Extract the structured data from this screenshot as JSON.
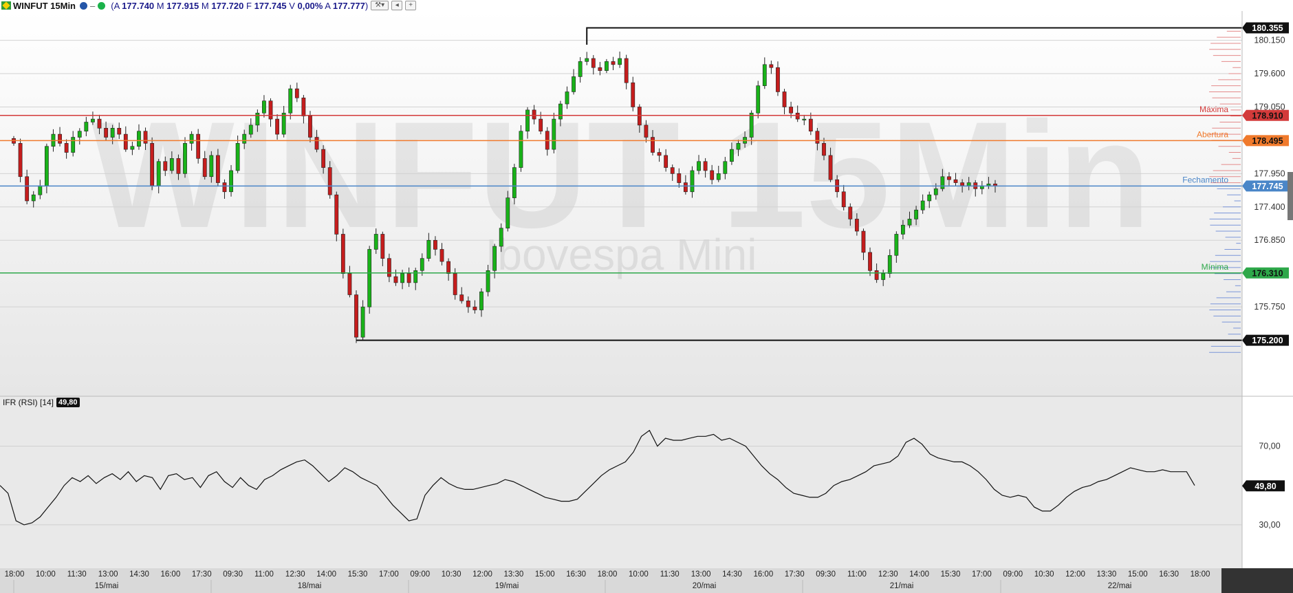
{
  "header": {
    "symbol": "WINFUT 15Min",
    "ohlc": [
      {
        "label": "A",
        "value": "177.740"
      },
      {
        "label": "M",
        "value": "177.915"
      },
      {
        "label": "M",
        "value": "177.720"
      },
      {
        "label": "F",
        "value": "177.745"
      },
      {
        "label": "V",
        "value": "0,00%"
      },
      {
        "label": "A",
        "value": "177.777"
      }
    ],
    "dropdown_value": "7"
  },
  "watermark": {
    "title": "WINFUT 15Min",
    "subtitle": "Ibovespa Mini"
  },
  "colors": {
    "up": "#19b219",
    "down": "#c51d1d",
    "maxima": "#d33a3a",
    "abertura": "#f07a2c",
    "fechamento": "#4a86c8",
    "minima": "#2ea84a"
  },
  "chart_data": [
    {
      "type": "candlestick",
      "title": "WINFUT 15Min",
      "ylim": [
        174900,
        180520
      ],
      "y_ticks": [
        "180.150",
        "179.600",
        "179.050",
        "177.950",
        "177.400",
        "176.850",
        "175.750"
      ],
      "ref_lines": [
        {
          "label": "Máxima",
          "value": 178910,
          "badge": "178.910",
          "color": "#d33a3a"
        },
        {
          "label": "Abertura",
          "value": 178495,
          "badge": "178.495",
          "color": "#f07a2c"
        },
        {
          "label": "Fechamento",
          "value": 177745,
          "badge": "177.745",
          "color": "#4a86c8"
        },
        {
          "label": "Mínima",
          "value": 176310,
          "badge": "176.310",
          "color": "#2ea84a"
        }
      ],
      "period_high": {
        "value": 180355,
        "label": "180.355"
      },
      "period_low": {
        "value": 175200,
        "label": "175.200"
      },
      "x_ticks": [
        "18:00",
        "10:00",
        "11:30",
        "13:00",
        "14:30",
        "16:00",
        "17:30",
        "09:30",
        "11:00",
        "12:30",
        "14:00",
        "15:30",
        "17:00",
        "09:00",
        "10:30",
        "12:00",
        "13:30",
        "15:00",
        "16:30",
        "18:00",
        "10:00",
        "11:30",
        "13:00",
        "14:30",
        "16:00",
        "17:30",
        "09:30",
        "11:00",
        "12:30",
        "14:00",
        "15:30",
        "17:00",
        "09:00",
        "10:30",
        "12:00",
        "13:30",
        "15:00",
        "16:30",
        "18:00"
      ],
      "day_labels": [
        "15/mai",
        "18/mai",
        "19/mai",
        "20/mai",
        "21/mai",
        "22/mai"
      ],
      "series_close": [
        178450,
        177900,
        177500,
        177600,
        177750,
        178400,
        178600,
        178450,
        178300,
        178550,
        178650,
        178800,
        178850,
        178700,
        178550,
        178700,
        178600,
        178350,
        178400,
        178650,
        178450,
        177750,
        178150,
        178000,
        178200,
        177950,
        178450,
        178600,
        178200,
        177900,
        178250,
        177800,
        177650,
        178000,
        178450,
        178600,
        178750,
        178950,
        179150,
        178850,
        178600,
        178950,
        179350,
        179200,
        178900,
        178550,
        178350,
        178050,
        177600,
        176950,
        176300,
        175950,
        175250,
        175750,
        176700,
        176950,
        176550,
        176250,
        176150,
        176300,
        176150,
        176350,
        176550,
        176850,
        176700,
        176500,
        176300,
        175950,
        175850,
        175750,
        175700,
        176000,
        176350,
        176750,
        177050,
        177550,
        178050,
        178650,
        179000,
        178850,
        178650,
        178350,
        178850,
        179100,
        179300,
        179550,
        179800,
        179850,
        179700,
        179650,
        179800,
        179750,
        179850,
        179450,
        179050,
        178750,
        178550,
        178300,
        178250,
        178050,
        177950,
        177800,
        177650,
        178000,
        178150,
        178000,
        177850,
        177950,
        178150,
        178350,
        178450,
        178550,
        178950,
        179400,
        179750,
        179700,
        179300,
        179050,
        178950,
        178850,
        178850,
        178650,
        178450,
        178250,
        177850,
        177650,
        177400,
        177200,
        177000,
        176650,
        176350,
        176200,
        176300,
        176600,
        176950,
        177100,
        177200,
        177350,
        177500,
        177600,
        177700,
        177900,
        177850,
        177800,
        177750,
        177800,
        177700,
        177750,
        177780,
        177745
      ],
      "rsi": {
        "label": "IFR (RSI) [14]",
        "current": "49,80",
        "ylim": [
          10,
          87
        ],
        "y_ticks": [
          "70,00",
          "30,00"
        ],
        "values": [
          50,
          46,
          32,
          30,
          31,
          34,
          39,
          44,
          50,
          54,
          52,
          55,
          51,
          54,
          56,
          53,
          57,
          52,
          55,
          54,
          48,
          55,
          56,
          53,
          54,
          49,
          55,
          57,
          52,
          49,
          54,
          50,
          48,
          53,
          55,
          58,
          60,
          62,
          63,
          60,
          56,
          52,
          55,
          59,
          57,
          54,
          52,
          50,
          45,
          40,
          36,
          32,
          33,
          45,
          50,
          54,
          51,
          49,
          48,
          48,
          49,
          50,
          51,
          53,
          52,
          50,
          48,
          46,
          44,
          43,
          42,
          42,
          43,
          47,
          51,
          55,
          58,
          60,
          62,
          67,
          75,
          78,
          70,
          74,
          73,
          73,
          74,
          75,
          75,
          76,
          73,
          74,
          72,
          70,
          65,
          60,
          56,
          53,
          49,
          46,
          45,
          44,
          44,
          46,
          50,
          52,
          53,
          55,
          57,
          60,
          61,
          62,
          65,
          72,
          74,
          71,
          66,
          64,
          63,
          62,
          62,
          60,
          57,
          53,
          48,
          45,
          44,
          45,
          44,
          39,
          37,
          37,
          40,
          44,
          47,
          49,
          50,
          52,
          53,
          55,
          57,
          59,
          58,
          57,
          57,
          58,
          57,
          57,
          57,
          50
        ]
      }
    }
  ]
}
